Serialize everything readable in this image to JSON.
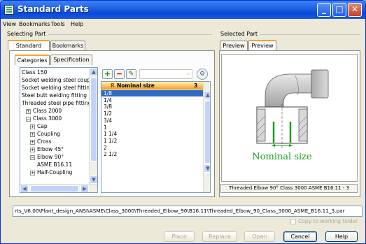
{
  "window": {
    "title": "Standard Parts"
  },
  "menu": [
    "View",
    "Bookmarks",
    "Tools",
    "Help"
  ],
  "selecting_part": {
    "label": "Selecting Part",
    "tabs": [
      "Standard Parts",
      "Bookmarks"
    ],
    "subtabs": [
      "Categories",
      "Specification"
    ],
    "tree": [
      {
        "text": "Class 150",
        "indent": 0,
        "expander": ""
      },
      {
        "text": "Socket welding steel coupl",
        "indent": 0,
        "expander": ""
      },
      {
        "text": "Socket welding steel fitting",
        "indent": 0,
        "expander": ""
      },
      {
        "text": "Steel butt welding fitting",
        "indent": 0,
        "expander": ""
      },
      {
        "text": "Threaded steel pipe fitting",
        "indent": 0,
        "expander": ""
      },
      {
        "text": "Class 2000",
        "indent": 1,
        "expander": "+"
      },
      {
        "text": "Class 3000",
        "indent": 1,
        "expander": "-"
      },
      {
        "text": "Cap",
        "indent": 2,
        "expander": "+"
      },
      {
        "text": "Coupling",
        "indent": 2,
        "expander": "+"
      },
      {
        "text": "Cross",
        "indent": 2,
        "expander": "+"
      },
      {
        "text": "Elbow 45°",
        "indent": 2,
        "expander": "+"
      },
      {
        "text": "Elbow 90°",
        "indent": 2,
        "expander": "-"
      },
      {
        "text": "ASME B16.11",
        "indent": 3,
        "expander": ""
      },
      {
        "text": "Half-Coupling",
        "indent": 2,
        "expander": "+"
      }
    ],
    "grid": {
      "headers": [
        "",
        "R",
        "Nominal size",
        "3"
      ],
      "rows": [
        "1/8",
        "1/4",
        "3/8",
        "1/2",
        "3/4",
        "1",
        "1 1/4",
        "1 1/2",
        "2",
        "2 1/2"
      ],
      "selected_index": 0
    }
  },
  "selected_part": {
    "label": "Selected Part",
    "tabs": [
      "Preview",
      "Preview 1"
    ],
    "annotation": "Nominal size",
    "caption": "Threaded Elbow 90° Class 3000 ASME B16.11 - 3"
  },
  "path": "rts_V6.00\\Plant_design_ANSI\\ASME\\Class_3000\\Threaded_Elbow_90\\B16.11\\Threaded_Elbow_90_Class_3000_ASME_B16.11_3.par",
  "copy_label": "Copy to working folder",
  "buttons": {
    "place": "Place",
    "replace": "Replace",
    "open": "Open",
    "cancel": "Cancel",
    "help": "Help"
  }
}
